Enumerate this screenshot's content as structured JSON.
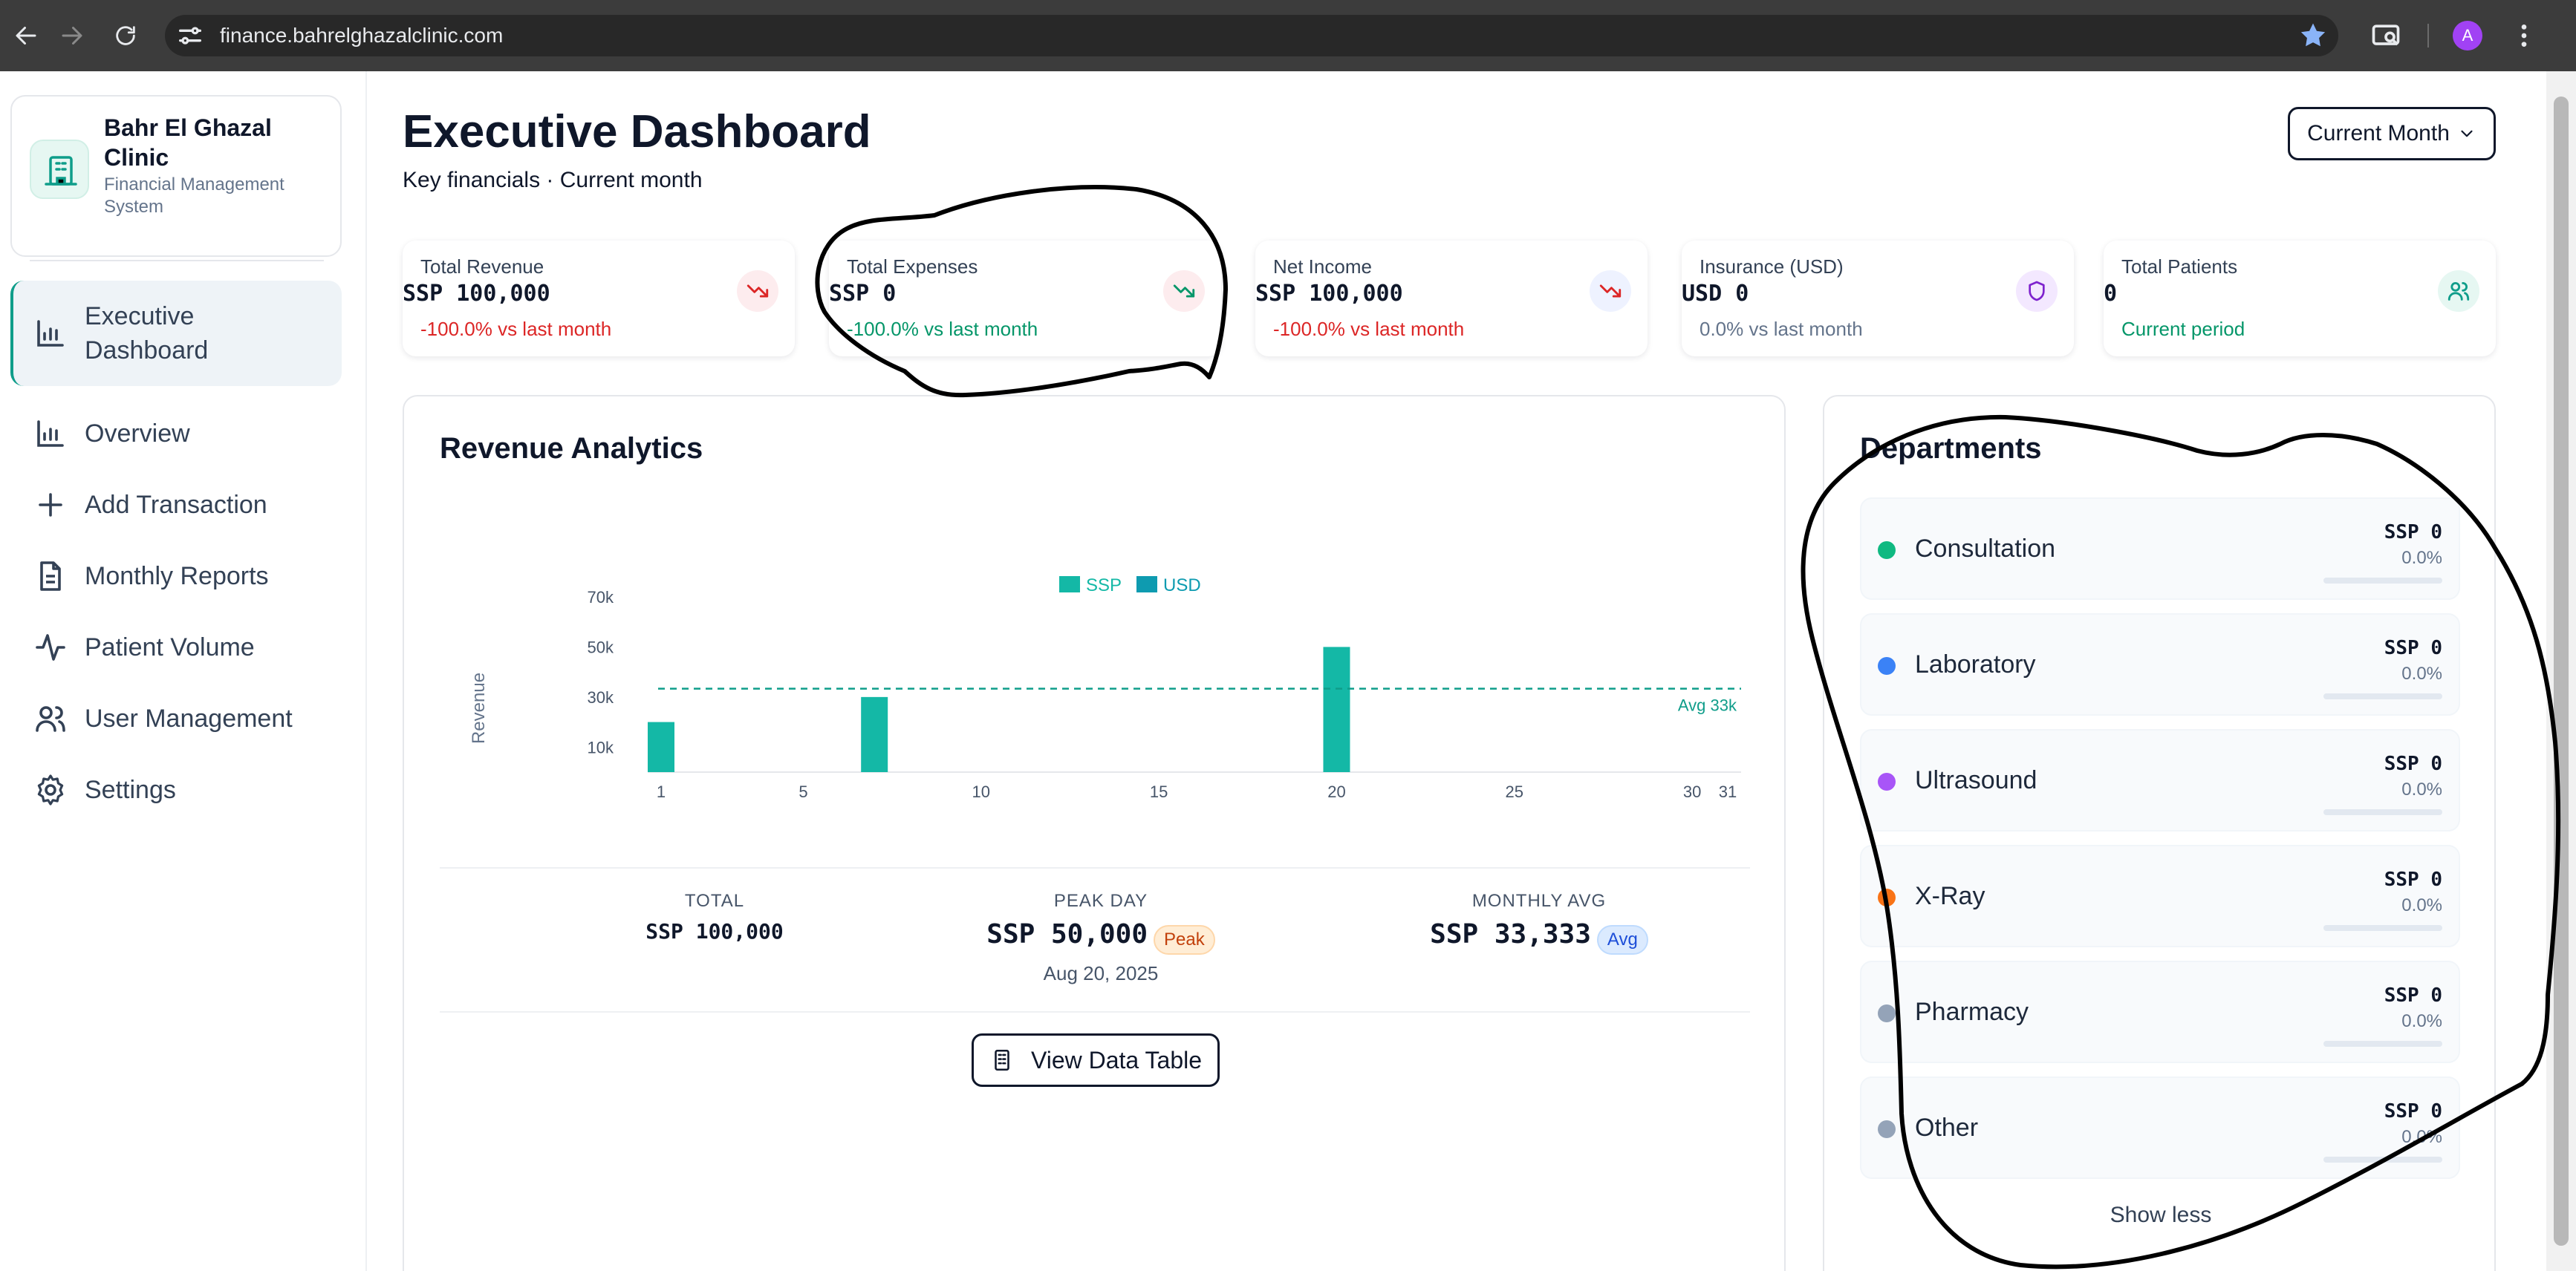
{
  "browser": {
    "url": "finance.bahrelghazalclinic.com",
    "profile_initial": "A"
  },
  "brand": {
    "name": "Bahr El Ghazal Clinic",
    "subtitle": "Financial Management System",
    "icon": "hospital-icon"
  },
  "nav": {
    "items": [
      {
        "label": "Executive Dashboard",
        "icon": "bar-chart-icon",
        "active": true
      },
      {
        "label": "Overview",
        "icon": "bar-chart-icon"
      },
      {
        "label": "Add Transaction",
        "icon": "plus-icon"
      },
      {
        "label": "Monthly Reports",
        "icon": "document-icon"
      },
      {
        "label": "Patient Volume",
        "icon": "activity-icon"
      },
      {
        "label": "User Management",
        "icon": "users-icon"
      },
      {
        "label": "Settings",
        "icon": "gear-icon"
      }
    ]
  },
  "header": {
    "title": "Executive Dashboard",
    "subtitle": "Key financials · Current month",
    "period_button": "Current Month"
  },
  "kpis": [
    {
      "label": "Total Revenue",
      "value": "SSP 100,000",
      "delta": "-100.0% vs last month",
      "tone": "negative",
      "icon": "trending-down-icon"
    },
    {
      "label": "Total Expenses",
      "value": "SSP 0",
      "delta": "-100.0% vs last month",
      "tone": "positive",
      "icon": "trending-down-icon"
    },
    {
      "label": "Net Income",
      "value": "SSP 100,000",
      "delta": "-100.0% vs last month",
      "tone": "negative",
      "icon": "trending-down-icon"
    },
    {
      "label": "Insurance (USD)",
      "value": "USD 0",
      "delta": "0.0% vs last month",
      "tone": "neutral",
      "icon": "shield-icon"
    },
    {
      "label": "Total Patients",
      "value": "0",
      "delta": "Current period",
      "tone": "positive",
      "icon": "users-icon"
    }
  ],
  "revenue": {
    "title": "Revenue Analytics",
    "summary": {
      "total_label": "TOTAL",
      "total_value": "SSP 100,000",
      "peak_label": "PEAK DAY",
      "peak_value": "SSP 50,000",
      "peak_badge": "Peak",
      "peak_date": "Aug 20, 2025",
      "avg_label": "MONTHLY AVG",
      "avg_value": "SSP 33,333",
      "avg_badge": "Avg"
    },
    "table_button": "View Data Table"
  },
  "chart_data": {
    "type": "bar",
    "ylabel": "Revenue",
    "xlabel": "",
    "legend": [
      "SSP",
      "USD"
    ],
    "legend_placement": "top-center",
    "x_ticks": [
      "1",
      "5",
      "10",
      "15",
      "20",
      "25",
      "30",
      "31"
    ],
    "y_ticks": [
      "10k",
      "30k",
      "50k",
      "70k"
    ],
    "ylim": [
      0,
      70000
    ],
    "xlim": [
      1,
      31
    ],
    "series": [
      {
        "name": "SSP",
        "color": "#14b8a6",
        "points": [
          {
            "x": 1,
            "y": 20000
          },
          {
            "x": 7,
            "y": 30000
          },
          {
            "x": 20,
            "y": 50000
          }
        ]
      },
      {
        "name": "USD",
        "color": "#0e9bb0",
        "points": []
      }
    ],
    "reference_line": {
      "value": 33333,
      "label": "Avg 33k",
      "color": "#0f9d8a"
    },
    "grid": false
  },
  "departments": {
    "title": "Departments",
    "items": [
      {
        "name": "Consultation",
        "value": "SSP 0",
        "pct": "0.0%",
        "share": 0,
        "color": "#10b981"
      },
      {
        "name": "Laboratory",
        "value": "SSP 0",
        "pct": "0.0%",
        "share": 0,
        "color": "#3b82f6"
      },
      {
        "name": "Ultrasound",
        "value": "SSP 0",
        "pct": "0.0%",
        "share": 0,
        "color": "#a855f7"
      },
      {
        "name": "X-Ray",
        "value": "SSP 0",
        "pct": "0.0%",
        "share": 0,
        "color": "#f97316"
      },
      {
        "name": "Pharmacy",
        "value": "SSP 0",
        "pct": "0.0%",
        "share": 0,
        "color": "#94a3b8"
      },
      {
        "name": "Other",
        "value": "SSP 0",
        "pct": "0.0%",
        "share": 0,
        "color": "#94a3b8"
      }
    ],
    "show_less": "Show less"
  }
}
